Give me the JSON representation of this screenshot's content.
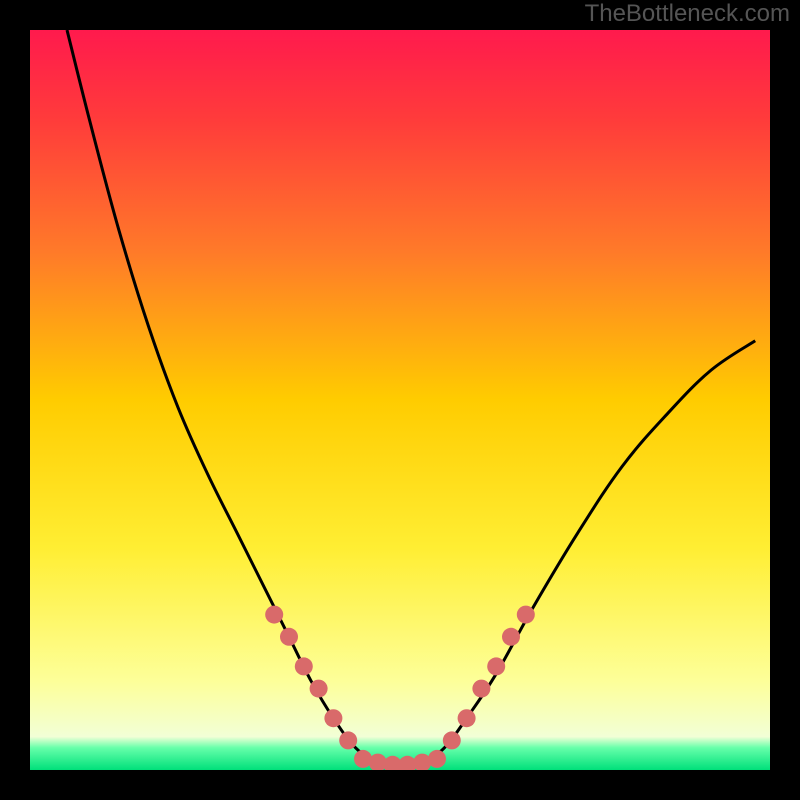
{
  "watermark": "TheBottleneck.com",
  "chart_data": {
    "type": "line",
    "title": "",
    "xlabel": "",
    "ylabel": "",
    "xlim": [
      0,
      100
    ],
    "ylim": [
      0,
      100
    ],
    "axes_visible": false,
    "curve": {
      "name": "bottleneck-curve",
      "x": [
        5,
        8,
        12,
        16,
        20,
        24,
        28,
        32,
        35,
        38,
        41,
        44,
        47,
        50,
        53,
        56,
        59,
        63,
        68,
        74,
        80,
        86,
        92,
        98
      ],
      "y": [
        100,
        88,
        73,
        60,
        49,
        40,
        32,
        24,
        18,
        12,
        7,
        3,
        1,
        0.5,
        1,
        3,
        7,
        13,
        22,
        32,
        41,
        48,
        54,
        58
      ]
    },
    "markers": {
      "name": "marker-points",
      "color": "#d96a6a",
      "x": [
        33,
        35,
        37,
        39,
        41,
        43,
        45,
        47,
        49,
        51,
        53,
        55,
        57,
        59,
        61,
        63,
        65,
        67
      ],
      "y": [
        21,
        18,
        14,
        11,
        7,
        4,
        1.5,
        1,
        0.7,
        0.7,
        1,
        1.5,
        4,
        7,
        11,
        14,
        18,
        21
      ]
    },
    "background_gradient": [
      {
        "pos": 0.0,
        "color": "#ff1a4d"
      },
      {
        "pos": 0.12,
        "color": "#ff3b3b"
      },
      {
        "pos": 0.3,
        "color": "#ff7a29"
      },
      {
        "pos": 0.5,
        "color": "#ffcc00"
      },
      {
        "pos": 0.7,
        "color": "#ffee33"
      },
      {
        "pos": 0.88,
        "color": "#fdff99"
      },
      {
        "pos": 0.955,
        "color": "#f2ffd6"
      },
      {
        "pos": 0.97,
        "color": "#66ffaa"
      },
      {
        "pos": 1.0,
        "color": "#00e07a"
      }
    ]
  }
}
